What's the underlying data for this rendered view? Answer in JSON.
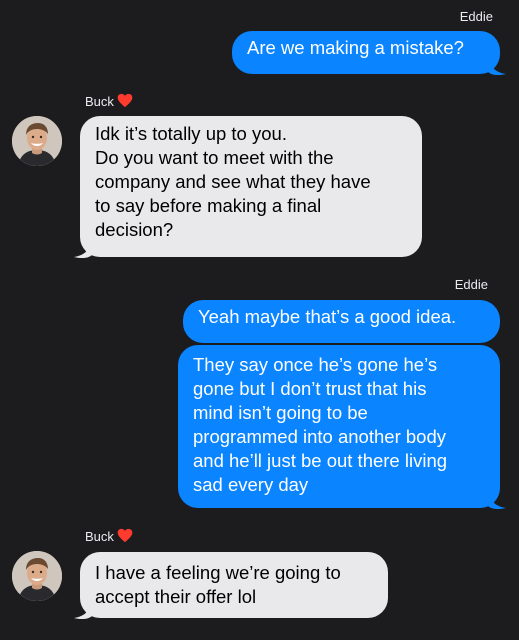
{
  "thread": {
    "contact_color": "#0a84ff",
    "messages": [
      {
        "sender": "Eddie",
        "direction": "outgoing",
        "lines": [
          "Are we making a mistake?"
        ]
      },
      {
        "sender": "Buck",
        "sender_icon": "red-heart-icon",
        "direction": "incoming",
        "avatar": "contact-photo-avatar",
        "lines": [
          "Idk it’s totally up to you.",
          "Do you want to meet with the",
          "company and see what they have",
          "to say before making a final",
          "decision?"
        ]
      },
      {
        "sender": "Eddie",
        "direction": "outgoing",
        "lines": [
          "Yeah maybe that’s a good idea."
        ]
      },
      {
        "direction": "outgoing",
        "lines": [
          "They say once he’s gone he’s",
          "gone but I don’t trust that his",
          "mind isn’t going to be",
          "programmed into another body",
          "and he’ll just be out there living",
          "sad every day"
        ]
      },
      {
        "sender": "Buck",
        "sender_icon": "red-heart-icon",
        "direction": "incoming",
        "avatar": "contact-photo-avatar",
        "lines": [
          "I have a feeling we’re going to",
          "accept their offer lol"
        ]
      }
    ]
  }
}
